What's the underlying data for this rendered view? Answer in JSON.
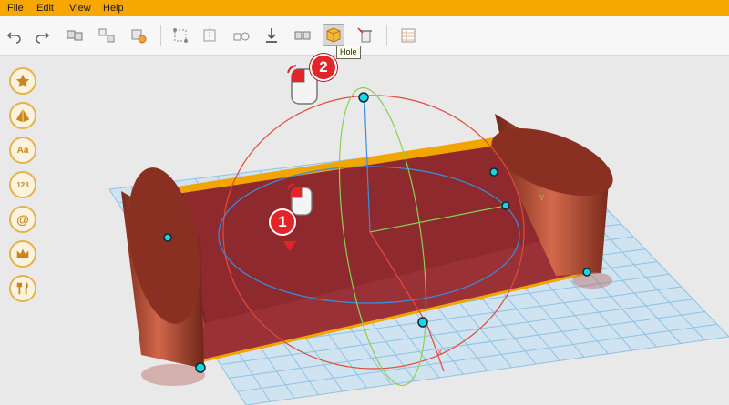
{
  "menu": {
    "items": [
      "File",
      "Edit",
      "View",
      "Help"
    ]
  },
  "toolbar": {
    "buttons": [
      {
        "name": "undo-icon"
      },
      {
        "name": "redo-icon"
      },
      {
        "name": "group-icon"
      },
      {
        "name": "ungroup-icon"
      },
      {
        "name": "align-icon"
      },
      {
        "name": "transform-icon"
      },
      {
        "name": "mirror-icon"
      },
      {
        "name": "copy-icon"
      },
      {
        "name": "drop-icon"
      },
      {
        "name": "split-icon"
      },
      {
        "name": "hole-icon",
        "active": true
      },
      {
        "name": "delete-icon"
      },
      {
        "name": "panel-icon"
      }
    ],
    "tooltip": "Hole"
  },
  "sidebar": {
    "items": [
      {
        "name": "favorites-icon"
      },
      {
        "name": "shapes-icon"
      },
      {
        "name": "text-icon",
        "label": "Aa"
      },
      {
        "name": "numbers-icon",
        "label": "123"
      },
      {
        "name": "symbols-icon",
        "label": "@"
      },
      {
        "name": "crown-icon"
      },
      {
        "name": "tools-icon"
      }
    ]
  },
  "steps": {
    "step1": "1",
    "step2": "2"
  },
  "axes": {
    "x_label": "X",
    "y_label": "Y"
  },
  "colors": {
    "menu_bar": "#f6a800",
    "accent": "#e4b34a",
    "object_fill": "#8e2a2e",
    "handle": "#19d6e3",
    "badge": "#e3242b"
  }
}
